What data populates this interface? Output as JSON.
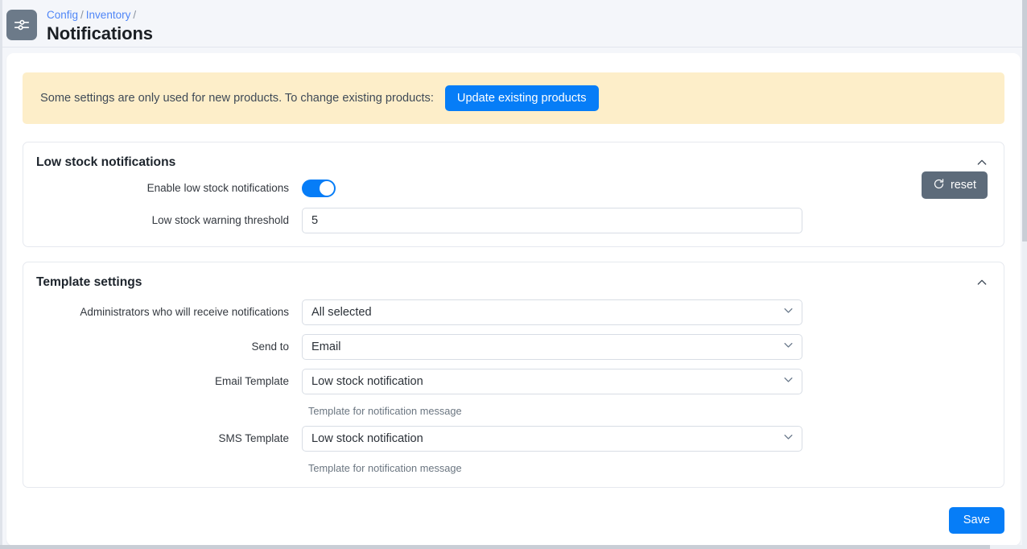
{
  "header": {
    "icon": "sliders-icon",
    "breadcrumb": [
      {
        "label": "Config",
        "link": true
      },
      {
        "label": "Inventory",
        "link": true
      }
    ],
    "separator": "/",
    "title": "Notifications"
  },
  "alert": {
    "message": "Some settings are only used for new products. To change existing products:",
    "button_label": "Update existing products",
    "background_color": "#fdeec9",
    "button_color": "#067df7"
  },
  "cards": [
    {
      "title": "Low stock notifications",
      "collapse_icon": "chevron-up-icon",
      "reset_button": {
        "label": "reset",
        "icon": "refresh-icon",
        "color": "#5d6b7a"
      },
      "fields": [
        {
          "label": "Enable low stock notifications",
          "type": "toggle",
          "value": "on",
          "accent_color": "#067df7"
        },
        {
          "label": "Low stock warning threshold",
          "type": "text",
          "value": "5",
          "placeholder": ""
        }
      ]
    },
    {
      "title": "Template settings",
      "collapse_icon": "chevron-up-icon",
      "fields": [
        {
          "label": "Administrators who will receive notifications",
          "type": "select",
          "value": "All selected",
          "help": ""
        },
        {
          "label": "Send to",
          "type": "select",
          "value": "Email",
          "help": ""
        },
        {
          "label": "Email Template",
          "type": "select",
          "value": "Low stock notification",
          "help": "Template for notification message"
        },
        {
          "label": "SMS Template",
          "type": "select",
          "value": "Low stock notification",
          "help": "Template for notification message"
        }
      ]
    }
  ],
  "footer": {
    "save_label": "Save",
    "save_color": "#067df7"
  }
}
